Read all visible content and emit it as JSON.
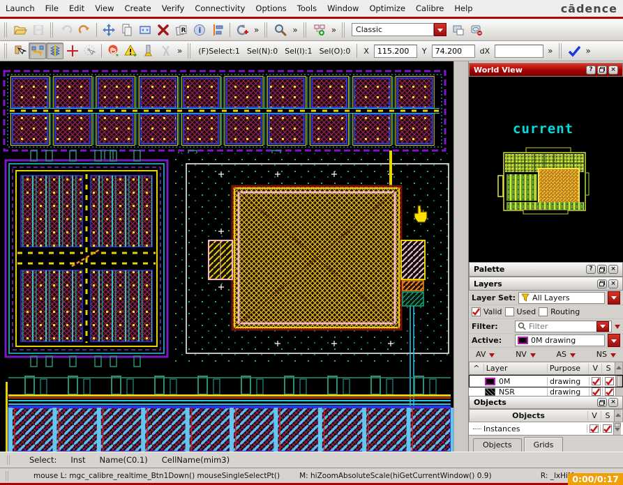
{
  "ui": {
    "more": "»",
    "help": "?",
    "close": "×",
    "sort_arrow": "^"
  },
  "menu": {
    "items": [
      "Launch",
      "File",
      "Edit",
      "View",
      "Create",
      "Verify",
      "Connectivity",
      "Options",
      "Tools",
      "Window",
      "Optimize",
      "Calibre",
      "Help"
    ],
    "logo": "cādence"
  },
  "toolbar_main": {
    "workspace_combo_value": "Classic"
  },
  "toolbar_edit": {
    "fselect": "(F)Select:1",
    "sel_n": "Sel(N):0",
    "sel_i": "Sel(I):1",
    "sel_o": "Sel(O):0",
    "x_label": "X",
    "x_value": "115.200",
    "y_label": "Y",
    "y_value": "74.200",
    "dx_label": "dX",
    "dx_value": ""
  },
  "world_view": {
    "title": "World View",
    "view_label": "current"
  },
  "palette": {
    "title": "Palette",
    "layers_title": "Layers",
    "layer_set_label": "Layer Set:",
    "layer_set_value": "All Layers",
    "checkboxes": [
      {
        "label": "Valid",
        "checked": true
      },
      {
        "label": "Used",
        "checked": false
      },
      {
        "label": "Routing",
        "checked": false
      }
    ],
    "filter_label": "Filter:",
    "filter_placeholder": "Filter",
    "active_label": "Active:",
    "active_value": "0M drawing",
    "visibility_buttons": [
      "AV",
      "NV",
      "AS",
      "NS"
    ],
    "layer_table": {
      "headers": {
        "layer": "Layer",
        "purpose": "Purpose",
        "v": "V",
        "s": "S"
      },
      "rows": [
        {
          "layer": "0M",
          "purpose": "drawing",
          "v": true,
          "s": true,
          "selected": true
        },
        {
          "layer": "NSR",
          "purpose": "drawing",
          "v": true,
          "s": true,
          "selected": false
        }
      ]
    },
    "objects_title": "Objects",
    "objects_table": {
      "headers": {
        "name": "Objects",
        "v": "V",
        "s": "S"
      },
      "rows": [
        {
          "name": "Instances",
          "v": true,
          "s": true
        }
      ]
    },
    "tabs": [
      "Objects",
      "Grids"
    ]
  },
  "status": {
    "select_label": "Select:",
    "items": [
      "Inst",
      "Name(C0.1)",
      "CellName(mim3)"
    ]
  },
  "prompt": {
    "mouse_left": "mouse L: mgc_calibre_realtime_Btn1Down() mouseSingleSelectPt()",
    "mouse_middle": "M: hiZoomAbsoluteScale(hiGetCurrentWindow() 0.9)",
    "mouse_right": "R: _lxHiM",
    "timer": "0:00/0:17"
  },
  "colors": {
    "titlebar_red": "#a30202",
    "dropdown_red": "#9a0d0d",
    "check_red": "#c81414",
    "timer_orange": "#f0a005",
    "canvas_bg": "#000000",
    "world_view_label": "#00dede",
    "selection_white": "#ffffff",
    "active_layer_swatch": "#c018c0"
  }
}
